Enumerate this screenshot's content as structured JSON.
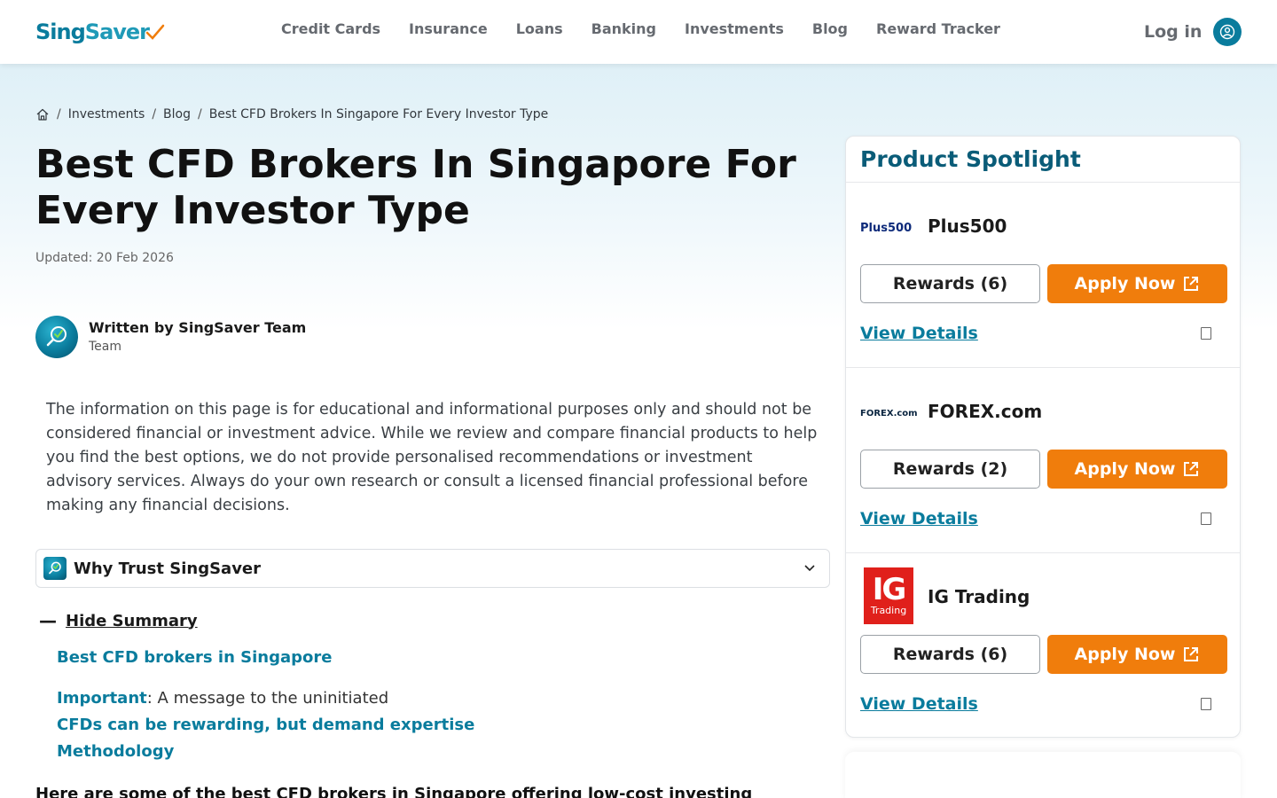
{
  "header": {
    "logo_left": "Sing",
    "logo_right": "Saver",
    "nav": [
      "Credit Cards",
      "Insurance",
      "Loans",
      "Banking",
      "Investments",
      "Blog",
      "Reward Tracker"
    ],
    "login": "Log in"
  },
  "breadcrumb": [
    "Investments",
    "Blog",
    "Best CFD Brokers In Singapore For Every Investor Type"
  ],
  "article": {
    "title": "Best CFD Brokers In Singapore For Every Investor Type",
    "updated": "Updated: 20 Feb 2026",
    "author_name": "Written by SingSaver Team",
    "author_role": "Team",
    "disclaimer": "The information on this page is for educational and informational purposes only and should not be considered financial or investment advice. While we review and compare financial products to help you find the best options, we do not provide personalised recommendations or investment advisory services. Always do your own research or consult a licensed financial professional before making any financial decisions.",
    "trust_label": "Why Trust SingSaver",
    "hide_summary": "Hide Summary",
    "summary": {
      "item1": "Best CFD brokers in Singapore",
      "item2_bold": "Important",
      "item2_rest": ": A message to the uninitiated",
      "item3": "CFDs can be rewarding, but demand expertise",
      "item4": "Methodology"
    },
    "bottom_text": "Here are some of the best CFD brokers in Singapore offering low-cost investing"
  },
  "spotlight": {
    "title": "Product Spotlight",
    "products": [
      {
        "name": "Plus500",
        "logo_text": "Plus500",
        "rewards": "Rewards (6)",
        "apply": "Apply Now",
        "details": "View Details"
      },
      {
        "name": "FOREX.com",
        "logo_text": "FOREX.com",
        "rewards": "Rewards (2)",
        "apply": "Apply Now",
        "details": "View Details"
      },
      {
        "name": "IG Trading",
        "logo_text": "IG",
        "logo_sub": "Trading",
        "rewards": "Rewards (6)",
        "apply": "Apply Now",
        "details": "View Details"
      }
    ]
  },
  "colors": {
    "brand": "#0a7c9d",
    "accent_orange": "#f07d0c",
    "spotlight_title": "#0a5c78",
    "ig_red": "#e0201b"
  }
}
